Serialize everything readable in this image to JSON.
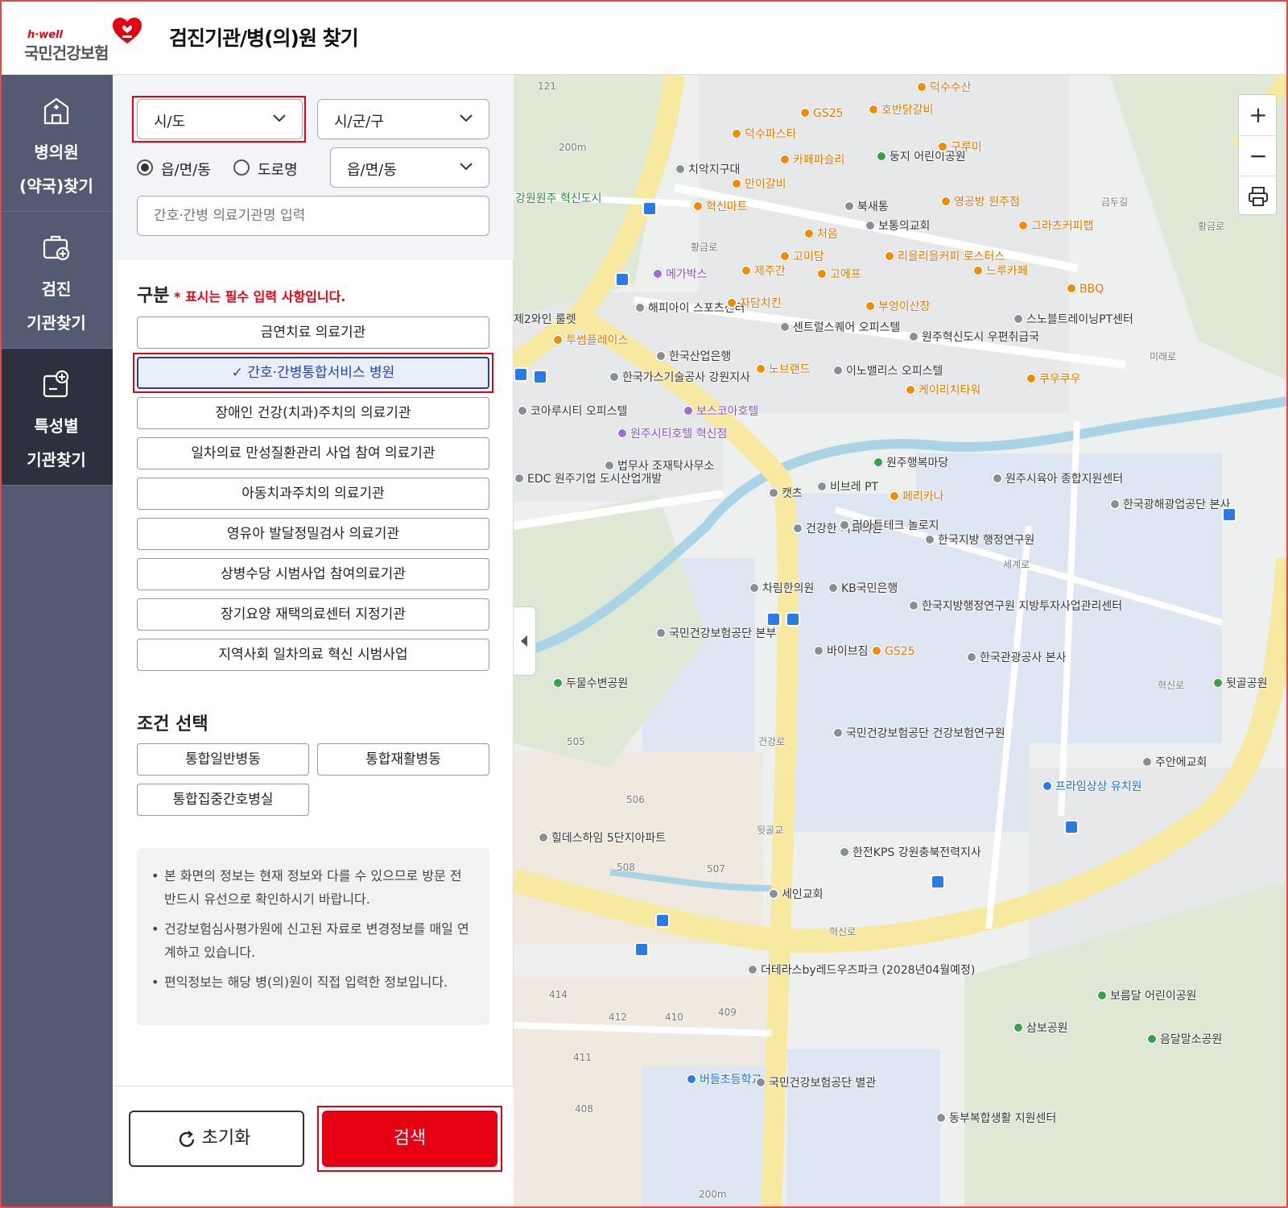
{
  "header": {
    "logo_top": "h·well",
    "logo_name": "국민건강보험",
    "page_title": "검진기관/병(의)원 찾기"
  },
  "nav": [
    {
      "line1": "병의원",
      "line2": "(약국)찾기",
      "icon": "hospital-icon"
    },
    {
      "line1": "검진",
      "line2": "기관찾기",
      "icon": "medical-bag-icon"
    },
    {
      "line1": "특성별",
      "line2": "기관찾기",
      "icon": "clipboard-plus-icon"
    }
  ],
  "filters": {
    "sido": "시/도",
    "sigungu": "시/군/구",
    "radio_1": "읍/면/동",
    "radio_2": "도로명",
    "dong": "읍/면/동",
    "name_placeholder": "간호·간병 의료기관명 입력"
  },
  "category": {
    "title": "구분",
    "required_note": "* 표시는 필수 입력 사항입니다.",
    "items": [
      "금연치료 의료기관",
      "✓ 간호·간병통합서비스 병원",
      "장애인 건강(치과)주치의 의료기관",
      "일차의료 만성질환관리 사업 참여 의료기관",
      "아동치과주치의 의료기관",
      "영유아 발달정밀검사 의료기관",
      "상병수당 시범사업 참여의료기관",
      "장기요양 재택의료센터 지정기관",
      "지역사회 일차의료 혁신 시범사업"
    ]
  },
  "conditions": {
    "title": "조건 선택",
    "items": [
      "통합일반병동",
      "통합재활병동",
      "통합집중간호병실"
    ]
  },
  "notice": [
    "본 화면의 정보는 현재 정보와 다를 수 있으므로 방문 전 반드시 유선으로 확인하시기 바랍니다.",
    "건강보험심사평가원에 신고된 자료로 변경정보를 매일 연계하고 있습니다.",
    "편익정보는 해당 병(의)원이 직접 입력한 정보입니다."
  ],
  "buttons": {
    "reset": "초기화",
    "search": "검색"
  },
  "map": {
    "zoom_in": "+",
    "zoom_out": "−",
    "scale_top": "200m",
    "scale_bottom": "200m",
    "labels": {
      "l01": "121",
      "l02": "덕수수산",
      "l03": "GS25",
      "l04": "호반닭갈비",
      "l05": "덕수파스타",
      "l06": "카페파슬리",
      "l07": "둥지 어린이공원",
      "l08": "구루미",
      "l09": "치악지구대",
      "l10": "만이갈비",
      "l11": "북새통",
      "l12": "영공방 원주점",
      "l13": "강원원주 혁신도시",
      "l14": "혁신마트",
      "l15": "보통의교회",
      "l16": "그라츠커피랩",
      "l17": "처음",
      "l18": "황금로",
      "l19": "고미담",
      "l20": "리을리을커피 로스터스",
      "l21": "느루카페",
      "l22": "메가박스",
      "l23": "제주간",
      "l24": "고에프",
      "l25": "부엉이산장",
      "l26": "BBQ",
      "l27": "해피아이 스포츠센터",
      "l28": "자담치킨",
      "l29": "센트럴스퀘어 오피스텔",
      "l30": "스노블트레이닝PT센터",
      "l31": "투썸플레이스",
      "l32": "한국산업은행",
      "l33": "원주혁신도시 우편취급국",
      "l34": "한국가스기술공사 강원지사",
      "l35": "노브랜드",
      "l36": "이노밸리스 오피스텔",
      "l37": "케이리치타워",
      "l38": "쿠우쿠우",
      "l39": "보스코아호텔",
      "l40": "코아루시티 오피스텔",
      "l41": "원주시티호텔 혁신점",
      "l42": "원주행복마당",
      "l43": "법무사 조재탁사무소",
      "l44": "EDC 원주기업 도시산업개발",
      "l45": "캣츠",
      "l46": "비브레 PT",
      "l47": "페리카나",
      "l48": "원주시육아 종합지원센터",
      "l49": "한국광해광업공단 본사",
      "l50": "건강한 치과의원",
      "l51": "러아튼테크 놀로지",
      "l52": "한국지방 행정연구원",
      "l53": "차림한의원",
      "l54": "KB국민은행",
      "l55": "한국지방행정연구원 지방투자사업관리센터",
      "l56": "국민건강보험공단 본부",
      "l57": "바이브짐",
      "l58": "GS25",
      "l59": "한국관광공사 본사",
      "l60": "두물수변공원",
      "l61": "뒷골공원",
      "l62": "국민건강보험공단 건강보험연구원",
      "l63": "505",
      "l64": "506",
      "l65": "주안에교회",
      "l66": "프라임상상 유치원",
      "l67": "힐데스하임 5단지아파트",
      "l68": "508",
      "l69": "507",
      "l70": "한전KPS 강원충북전력지사",
      "l71": "세인교회",
      "l72": "혁신로",
      "l73": "더테라스by레드우즈파크 (2028년04월예정)",
      "l74": "414",
      "l75": "412",
      "l76": "410",
      "l77": "409",
      "l78": "411",
      "l79": "보름달 어린이공원",
      "l80": "삼보공원",
      "l81": "음달말소공원",
      "l82": "408",
      "l83": "버들초등학교",
      "l84": "국민건강보험공단 별관",
      "l85": "동부복합생활 지원센터",
      "l86": "건강로",
      "l87": "뒷골교",
      "l88": "세계로",
      "l89": "미래로",
      "l90": "혁신로",
      "l91": "금두길",
      "l92": "황금로",
      "l93": "제2와인 룰렛"
    }
  },
  "colors": {
    "accent": "#e60012",
    "nav_bg": "#545a72",
    "nav_active": "#2e3040",
    "selected_border": "#2a3f8f"
  }
}
